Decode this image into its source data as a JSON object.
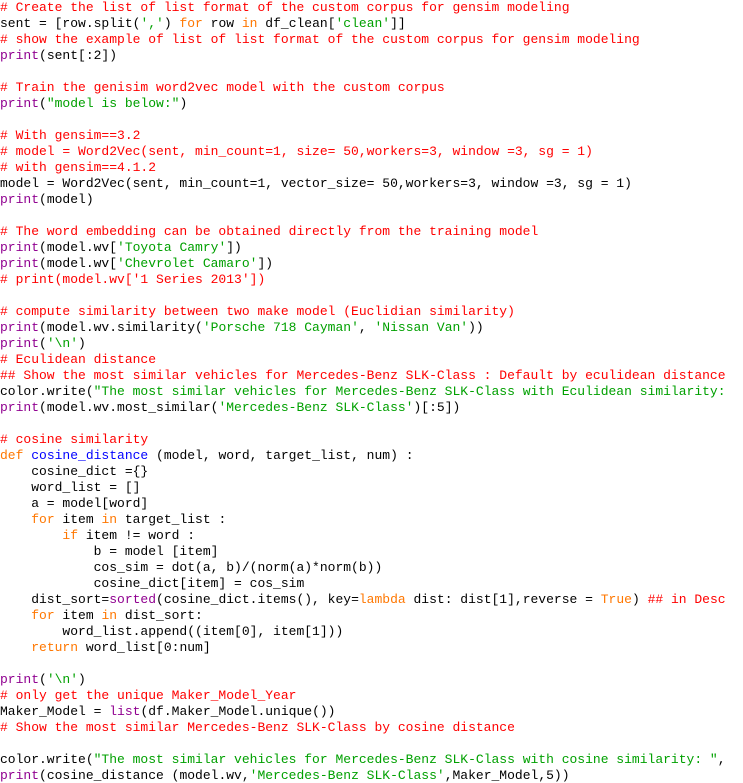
{
  "editor": {
    "colors": {
      "comment": "#ff0000",
      "string": "#00a000",
      "keyword": "#ff7700",
      "builtin": "#900090",
      "defname": "#0000ff",
      "plain": "#000000"
    },
    "lines": [
      [
        [
          "comment",
          "# Create the list of list format of the custom corpus for gensim modeling"
        ]
      ],
      [
        [
          "plain",
          "sent = [row.split("
        ],
        [
          "string",
          "','"
        ],
        [
          "plain",
          ") "
        ],
        [
          "keyword",
          "for"
        ],
        [
          "plain",
          " row "
        ],
        [
          "keyword",
          "in"
        ],
        [
          "plain",
          " df_clean["
        ],
        [
          "string",
          "'clean'"
        ],
        [
          "plain",
          "]]"
        ]
      ],
      [
        [
          "comment",
          "# show the example of list of list format of the custom corpus for gensim modeling"
        ]
      ],
      [
        [
          "builtin",
          "print"
        ],
        [
          "plain",
          "(sent[:2])"
        ]
      ],
      [],
      [
        [
          "comment",
          "# Train the genisim word2vec model with the custom corpus"
        ]
      ],
      [
        [
          "builtin",
          "print"
        ],
        [
          "plain",
          "("
        ],
        [
          "string",
          "\"model is below:\""
        ],
        [
          "plain",
          ")"
        ]
      ],
      [],
      [
        [
          "comment",
          "# With gensim==3.2"
        ]
      ],
      [
        [
          "comment",
          "# model = Word2Vec(sent, min_count=1, size= 50,workers=3, window =3, sg = 1)"
        ]
      ],
      [
        [
          "comment",
          "# with gensim==4.1.2"
        ]
      ],
      [
        [
          "plain",
          "model = Word2Vec(sent, min_count=1, vector_size= 50,workers=3, window =3, sg = 1)"
        ]
      ],
      [
        [
          "builtin",
          "print"
        ],
        [
          "plain",
          "(model)"
        ]
      ],
      [],
      [
        [
          "comment",
          "# The word embedding can be obtained directly from the training model"
        ]
      ],
      [
        [
          "builtin",
          "print"
        ],
        [
          "plain",
          "(model.wv["
        ],
        [
          "string",
          "'Toyota Camry'"
        ],
        [
          "plain",
          "])"
        ]
      ],
      [
        [
          "builtin",
          "print"
        ],
        [
          "plain",
          "(model.wv["
        ],
        [
          "string",
          "'Chevrolet Camaro'"
        ],
        [
          "plain",
          "])"
        ]
      ],
      [
        [
          "comment",
          "# print(model.wv['1 Series 2013'])"
        ]
      ],
      [],
      [
        [
          "comment",
          "# compute similarity between two make model (Euclidian similarity)"
        ]
      ],
      [
        [
          "builtin",
          "print"
        ],
        [
          "plain",
          "(model.wv.similarity("
        ],
        [
          "string",
          "'Porsche 718 Cayman'"
        ],
        [
          "plain",
          ", "
        ],
        [
          "string",
          "'Nissan Van'"
        ],
        [
          "plain",
          "))"
        ]
      ],
      [
        [
          "builtin",
          "print"
        ],
        [
          "plain",
          "("
        ],
        [
          "string",
          "'\\n'"
        ],
        [
          "plain",
          ")"
        ]
      ],
      [
        [
          "comment",
          "# Eculidean distance"
        ]
      ],
      [
        [
          "comment",
          "## Show the most similar vehicles for Mercedes-Benz SLK-Class : Default by eculidean distance"
        ]
      ],
      [
        [
          "plain",
          "color.write("
        ],
        [
          "string",
          "\"The most similar vehicles for Mercedes-Benz SLK-Class with Eculidean similarity:"
        ]
      ],
      [
        [
          "builtin",
          "print"
        ],
        [
          "plain",
          "(model.wv.most_similar("
        ],
        [
          "string",
          "'Mercedes-Benz SLK-Class'"
        ],
        [
          "plain",
          ")[:5])"
        ]
      ],
      [],
      [
        [
          "comment",
          "# cosine similarity"
        ]
      ],
      [
        [
          "keyword",
          "def"
        ],
        [
          "plain",
          " "
        ],
        [
          "defname",
          "cosine_distance"
        ],
        [
          "plain",
          " (model, word, target_list, num) :"
        ]
      ],
      [
        [
          "plain",
          "    cosine_dict ={}"
        ]
      ],
      [
        [
          "plain",
          "    word_list = []"
        ]
      ],
      [
        [
          "plain",
          "    a = model[word]"
        ]
      ],
      [
        [
          "plain",
          "    "
        ],
        [
          "keyword",
          "for"
        ],
        [
          "plain",
          " item "
        ],
        [
          "keyword",
          "in"
        ],
        [
          "plain",
          " target_list :"
        ]
      ],
      [
        [
          "plain",
          "        "
        ],
        [
          "keyword",
          "if"
        ],
        [
          "plain",
          " item != word :"
        ]
      ],
      [
        [
          "plain",
          "            b = model [item]"
        ]
      ],
      [
        [
          "plain",
          "            cos_sim = dot(a, b)/(norm(a)*norm(b))"
        ]
      ],
      [
        [
          "plain",
          "            cosine_dict[item] = cos_sim"
        ]
      ],
      [
        [
          "plain",
          "    dist_sort="
        ],
        [
          "builtin",
          "sorted"
        ],
        [
          "plain",
          "(cosine_dict.items(), key="
        ],
        [
          "keyword",
          "lambda"
        ],
        [
          "plain",
          " dist: dist[1],reverse = "
        ],
        [
          "keyword",
          "True"
        ],
        [
          "plain",
          ") "
        ],
        [
          "comment",
          "## in Desc"
        ]
      ],
      [
        [
          "plain",
          "    "
        ],
        [
          "keyword",
          "for"
        ],
        [
          "plain",
          " item "
        ],
        [
          "keyword",
          "in"
        ],
        [
          "plain",
          " dist_sort:"
        ]
      ],
      [
        [
          "plain",
          "        word_list.append((item[0], item[1]))"
        ]
      ],
      [
        [
          "plain",
          "    "
        ],
        [
          "keyword",
          "return"
        ],
        [
          "plain",
          " word_list[0:num]"
        ]
      ],
      [],
      [
        [
          "builtin",
          "print"
        ],
        [
          "plain",
          "("
        ],
        [
          "string",
          "'\\n'"
        ],
        [
          "plain",
          ")"
        ]
      ],
      [
        [
          "comment",
          "# only get the unique Maker_Model_Year"
        ]
      ],
      [
        [
          "plain",
          "Maker_Model = "
        ],
        [
          "builtin",
          "list"
        ],
        [
          "plain",
          "(df.Maker_Model.unique())"
        ]
      ],
      [
        [
          "comment",
          "# Show the most similar Mercedes-Benz SLK-Class by cosine distance"
        ]
      ],
      [],
      [
        [
          "plain",
          "color.write("
        ],
        [
          "string",
          "\"The most similar vehicles for Mercedes-Benz SLK-Class with cosine similarity: \""
        ],
        [
          "plain",
          ","
        ]
      ],
      [
        [
          "builtin",
          "print"
        ],
        [
          "plain",
          "(cosine_distance (model.wv,"
        ],
        [
          "string",
          "'Mercedes-Benz SLK-Class'"
        ],
        [
          "plain",
          ",Maker_Model,5))"
        ]
      ]
    ]
  }
}
